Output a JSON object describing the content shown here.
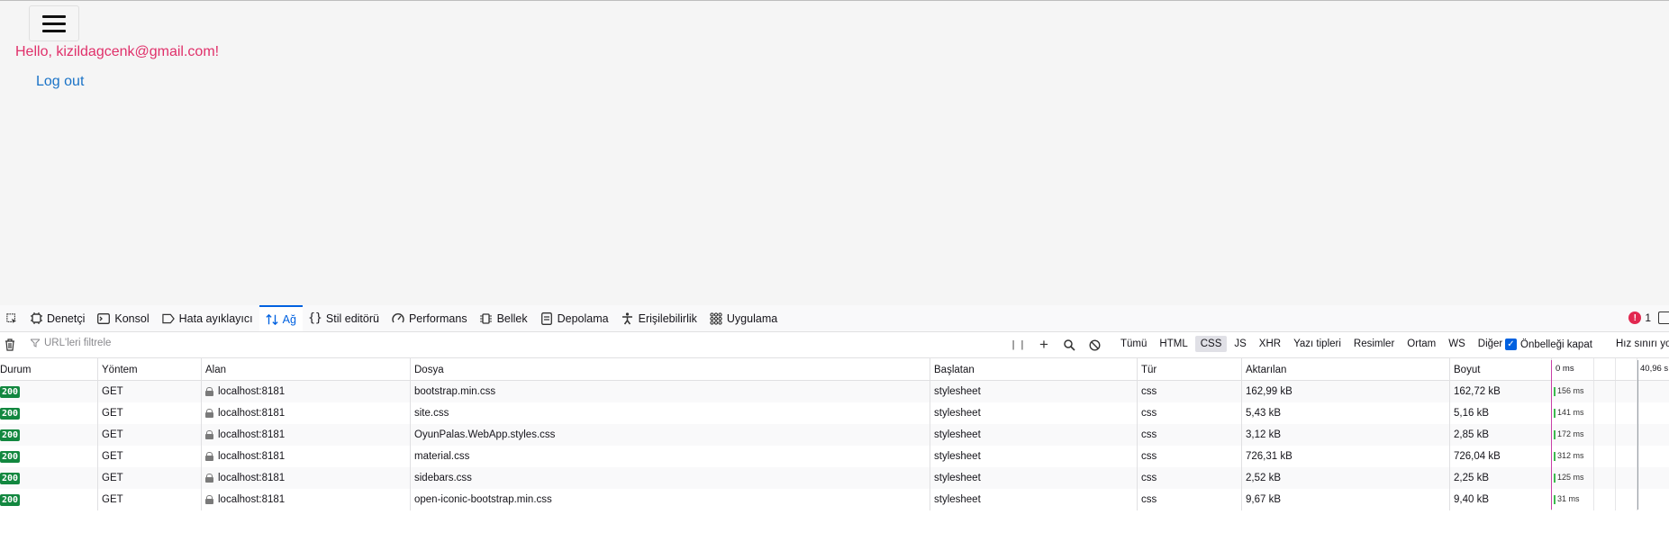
{
  "page": {
    "greeting": "Hello, kizildagcenk@gmail.com!",
    "logout": "Log out"
  },
  "devtools": {
    "tabs": [
      {
        "label": "Denetçi",
        "icon": "inspector-icon"
      },
      {
        "label": "Konsol",
        "icon": "console-icon"
      },
      {
        "label": "Hata ayıklayıcı",
        "icon": "debugger-icon"
      },
      {
        "label": "Ağ",
        "icon": "network-icon",
        "active": true
      },
      {
        "label": "Stil editörü",
        "icon": "style-editor-icon"
      },
      {
        "label": "Performans",
        "icon": "performance-icon"
      },
      {
        "label": "Bellek",
        "icon": "memory-icon"
      },
      {
        "label": "Depolama",
        "icon": "storage-icon"
      },
      {
        "label": "Erişilebilirlik",
        "icon": "accessibility-icon"
      },
      {
        "label": "Uygulama",
        "icon": "application-icon"
      }
    ],
    "error_count": "1",
    "filter_placeholder": "URL'leri filtrele",
    "type_filters": [
      "Tümü",
      "HTML",
      "CSS",
      "JS",
      "XHR",
      "Yazı tipleri",
      "Resimler",
      "Ortam",
      "WS",
      "Diğer"
    ],
    "active_type_filter": "CSS",
    "disable_cache_label": "Önbelleği kapat",
    "throttle_label": "Hız sınırı yo",
    "columns": {
      "status": "Durum",
      "method": "Yöntem",
      "domain": "Alan",
      "file": "Dosya",
      "initiator": "Başlatan",
      "type": "Tür",
      "transferred": "Aktarılan",
      "size": "Boyut",
      "wf_start": "0 ms",
      "wf_end": "40,96 s"
    },
    "rows": [
      {
        "status": "200",
        "method": "GET",
        "domain": "localhost:8181",
        "file": "bootstrap.min.css",
        "initiator": "stylesheet",
        "type": "css",
        "transferred": "162,99 kB",
        "size": "162,72 kB",
        "timing": "156 ms"
      },
      {
        "status": "200",
        "method": "GET",
        "domain": "localhost:8181",
        "file": "site.css",
        "initiator": "stylesheet",
        "type": "css",
        "transferred": "5,43 kB",
        "size": "5,16 kB",
        "timing": "141 ms"
      },
      {
        "status": "200",
        "method": "GET",
        "domain": "localhost:8181",
        "file": "OyunPalas.WebApp.styles.css",
        "initiator": "stylesheet",
        "type": "css",
        "transferred": "3,12 kB",
        "size": "2,85 kB",
        "timing": "172 ms"
      },
      {
        "status": "200",
        "method": "GET",
        "domain": "localhost:8181",
        "file": "material.css",
        "initiator": "stylesheet",
        "type": "css",
        "transferred": "726,31 kB",
        "size": "726,04 kB",
        "timing": "312 ms"
      },
      {
        "status": "200",
        "method": "GET",
        "domain": "localhost:8181",
        "file": "sidebars.css",
        "initiator": "stylesheet",
        "type": "css",
        "transferred": "2,52 kB",
        "size": "2,25 kB",
        "timing": "125 ms"
      },
      {
        "status": "200",
        "method": "GET",
        "domain": "localhost:8181",
        "file": "open-iconic-bootstrap.min.css",
        "initiator": "stylesheet",
        "type": "css",
        "transferred": "9,67 kB",
        "size": "9,40 kB",
        "timing": "31 ms"
      }
    ]
  }
}
